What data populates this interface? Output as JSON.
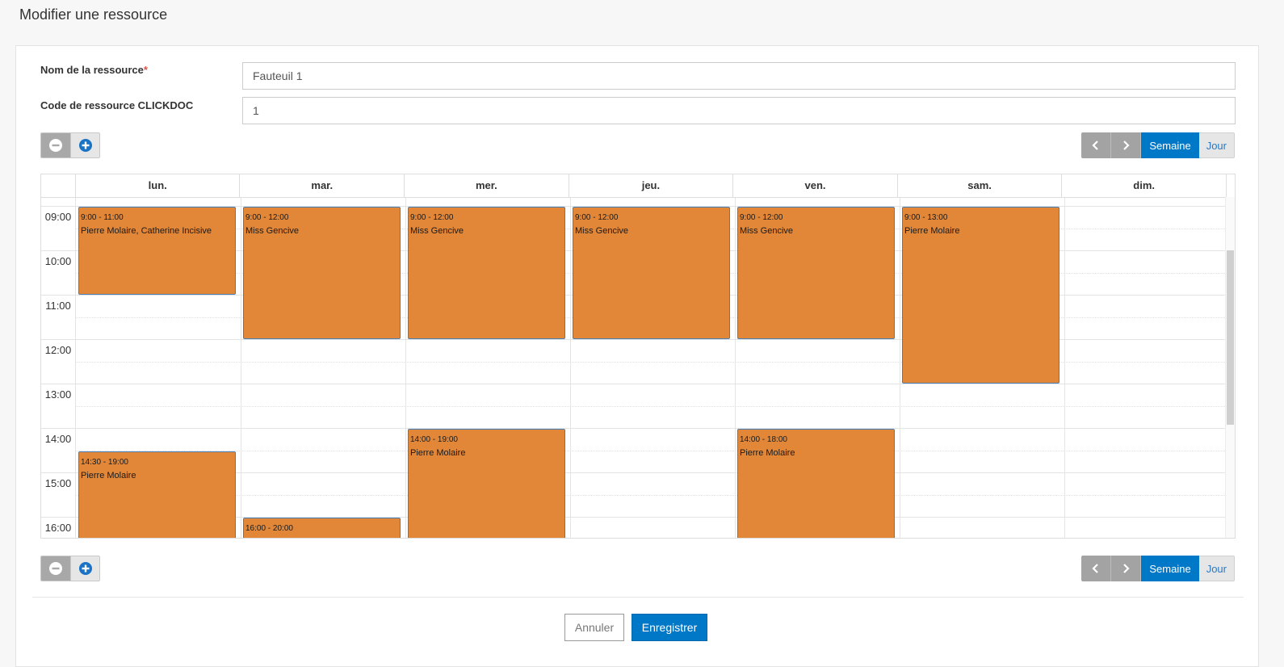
{
  "page": {
    "title": "Modifier une ressource"
  },
  "form": {
    "name_label": "Nom de la ressource",
    "required_mark": "*",
    "name_value": "Fauteuil 1",
    "code_label": "Code de ressource CLICKDOC",
    "code_value": "1"
  },
  "calendar": {
    "view_week": "Semaine",
    "view_day": "Jour",
    "days": [
      "lun.",
      "mar.",
      "mer.",
      "jeu.",
      "ven.",
      "sam.",
      "dim."
    ],
    "hours": [
      "09:00",
      "10:00",
      "11:00",
      "12:00",
      "13:00",
      "14:00",
      "15:00",
      "16:00"
    ],
    "events": [
      {
        "day": 0,
        "start": 9,
        "end": 11,
        "time": "9:00 - 11:00",
        "name": "Pierre Molaire, Catherine Incisive"
      },
      {
        "day": 1,
        "start": 9,
        "end": 12,
        "time": "9:00 - 12:00",
        "name": "Miss Gencive"
      },
      {
        "day": 2,
        "start": 9,
        "end": 12,
        "time": "9:00 - 12:00",
        "name": "Miss Gencive"
      },
      {
        "day": 3,
        "start": 9,
        "end": 12,
        "time": "9:00 - 12:00",
        "name": "Miss Gencive"
      },
      {
        "day": 4,
        "start": 9,
        "end": 12,
        "time": "9:00 - 12:00",
        "name": "Miss Gencive"
      },
      {
        "day": 5,
        "start": 9,
        "end": 13,
        "time": "9:00 - 13:00",
        "name": "Pierre Molaire"
      },
      {
        "day": 0,
        "start": 14.5,
        "end": 19,
        "time": "14:30 - 19:00",
        "name": "Pierre Molaire"
      },
      {
        "day": 2,
        "start": 14,
        "end": 19,
        "time": "14:00 - 19:00",
        "name": "Pierre Molaire"
      },
      {
        "day": 4,
        "start": 14,
        "end": 18,
        "time": "14:00 - 18:00",
        "name": "Pierre Molaire"
      },
      {
        "day": 1,
        "start": 16,
        "end": 20,
        "time": "16:00 - 20:00",
        "name": ""
      }
    ]
  },
  "actions": {
    "cancel": "Annuler",
    "save": "Enregistrer"
  },
  "colors": {
    "primary": "#0078c8",
    "event": "#e28638",
    "event_border": "#4a7fb5"
  },
  "icons": {
    "zoom_out": "minus-circle-icon",
    "zoom_in": "plus-circle-icon",
    "prev": "chevron-left-icon",
    "next": "chevron-right-icon"
  }
}
